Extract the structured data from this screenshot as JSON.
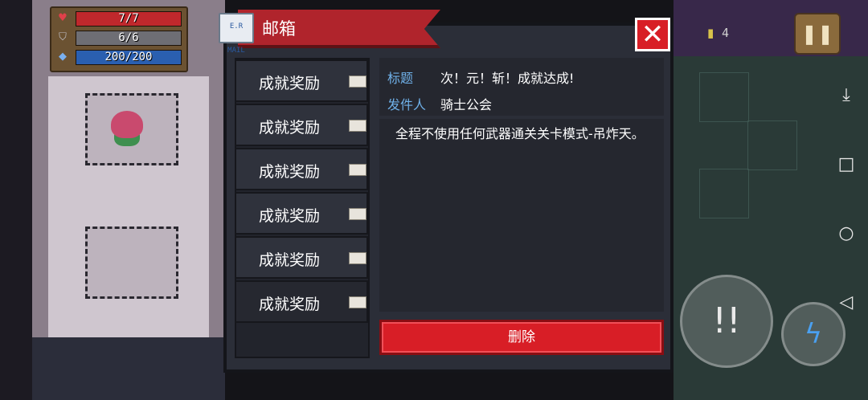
{
  "hud": {
    "health": "7/7",
    "armor": "6/6",
    "energy": "200/200",
    "health_color": "#c0282c",
    "armor_color": "#6e6e74",
    "energy_color": "#2a5fb0"
  },
  "coins": {
    "count": "4"
  },
  "dialog": {
    "title": "邮箱",
    "mail_icon_text": "E.R MAIL",
    "close_icon": "close-icon",
    "mails": [
      {
        "label": "成就奖励"
      },
      {
        "label": "成就奖励"
      },
      {
        "label": "成就奖励"
      },
      {
        "label": "成就奖励"
      },
      {
        "label": "成就奖励"
      },
      {
        "label": "成就奖励"
      }
    ],
    "detail": {
      "subject_label": "标题",
      "subject": "次！元！斩！成就达成!",
      "sender_label": "发件人",
      "sender": "骑士公会",
      "body": "全程不使用任何武器通关关卡模式-吊炸天。"
    },
    "delete_label": "删除"
  },
  "colors": {
    "accent_red": "#d81e26",
    "label_blue": "#6fb0e8",
    "panel": "#2b2e38"
  }
}
